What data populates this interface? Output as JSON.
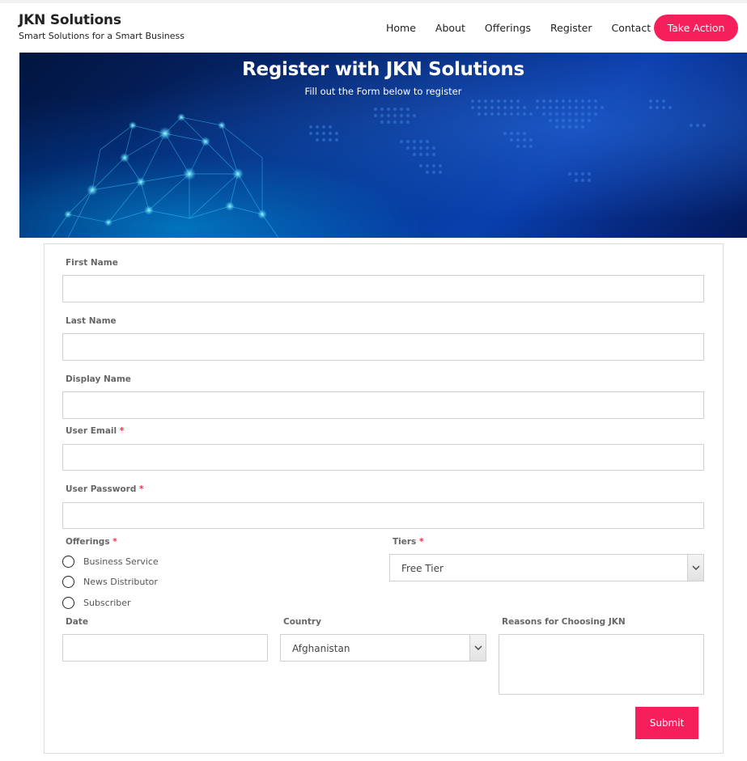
{
  "header": {
    "title": "JKN Solutions",
    "tagline": "Smart Solutions for a Smart Business",
    "nav": [
      "Home",
      "About",
      "Offerings",
      "Register",
      "Contact"
    ],
    "cta_label": "Take Action"
  },
  "hero": {
    "title": "Register with JKN Solutions",
    "subtitle": "Fill out the Form below to register"
  },
  "form": {
    "first_name": {
      "label": "First Name",
      "value": ""
    },
    "last_name": {
      "label": "Last Name",
      "value": ""
    },
    "display_name": {
      "label": "Display Name",
      "value": ""
    },
    "user_email": {
      "label": "User Email",
      "required": "*",
      "value": ""
    },
    "user_password": {
      "label": "User Password",
      "required": "*",
      "value": ""
    },
    "offerings": {
      "label": "Offerings",
      "required": "*",
      "options": [
        "Business Service",
        "News Distributor",
        "Subscriber"
      ],
      "selected": ""
    },
    "tiers": {
      "label": "Tiers",
      "required": "*",
      "selected": "Free Tier"
    },
    "date": {
      "label": "Date",
      "value": ""
    },
    "country": {
      "label": "Country",
      "selected": "Afghanistan"
    },
    "reasons": {
      "label": "Reasons for Choosing JKN",
      "value": ""
    },
    "submit_label": "Submit"
  },
  "colors": {
    "accent": "#f51f5c",
    "required": "#e8334a",
    "hero_dark": "#02153f",
    "hero_light": "#0a3aa8"
  },
  "icons": [
    "chevron-down-icon",
    "radio-unchecked-icon"
  ]
}
